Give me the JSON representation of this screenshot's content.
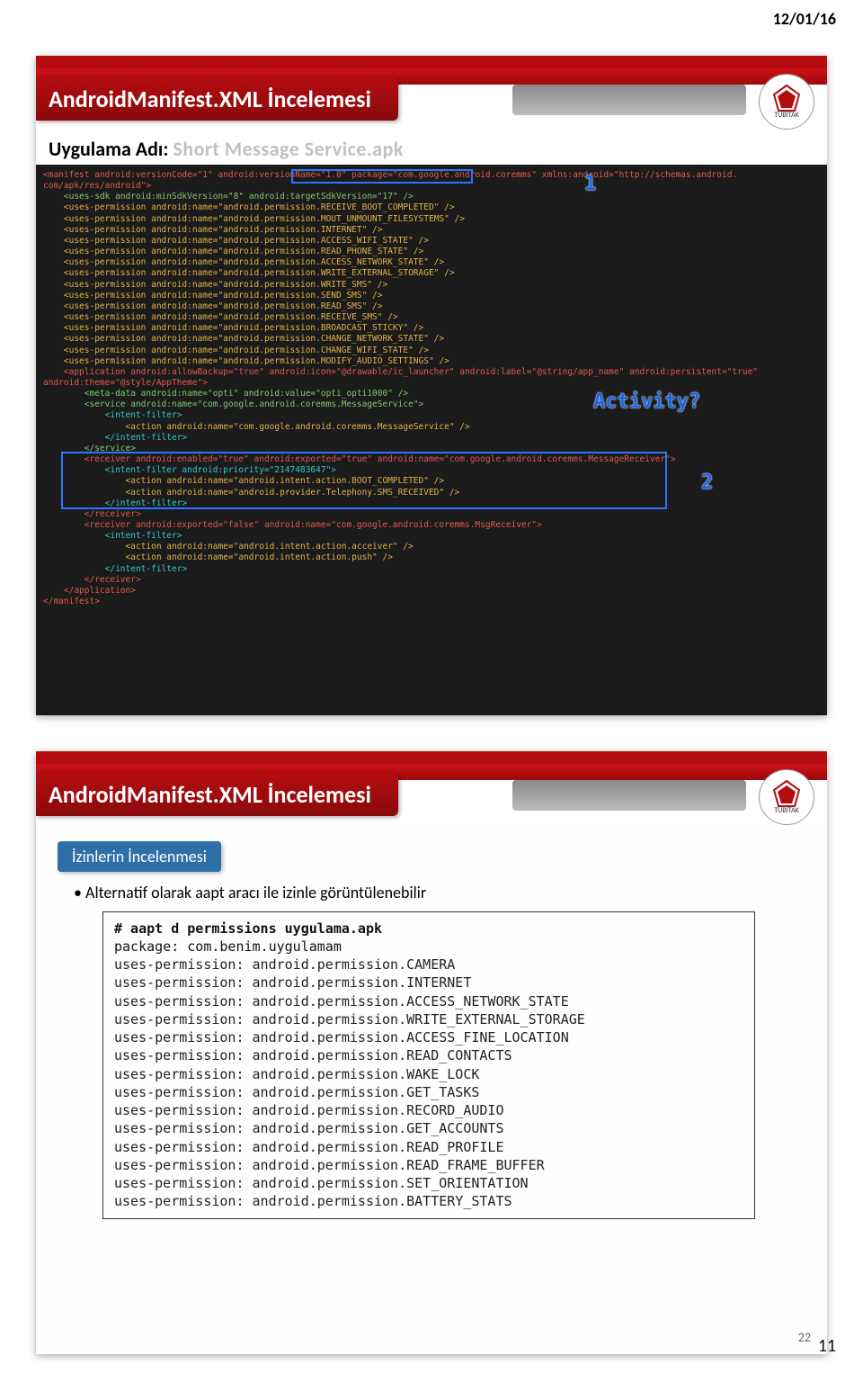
{
  "date": "12/01/16",
  "footer_page": "11",
  "slide1": {
    "title": "AndroidManifest.XML İncelemesi",
    "logo_caption": "TÜBİTAK",
    "app_label": "Uygulama Adı: ",
    "app_name": "Short Message Service.apk",
    "annot_1": "1",
    "annot_2": "2",
    "annot_activity": "Activity?",
    "manifest_lines": [
      {
        "cls": "c-red",
        "txt": "<manifest android:versionCode=\"1\" android:versionName=\"1.0\" package=\"com.google.android.coremms\" xmlns:android=\"http://schemas.android."
      },
      {
        "cls": "c-red",
        "txt": "com/apk/res/android\">"
      },
      {
        "cls": "c-green",
        "txt": "    <uses-sdk android:minSdkVersion=\"8\" android:targetSdkVersion=\"17\" />"
      },
      {
        "cls": "c-orange",
        "txt": "    <uses-permission android:name=\"android.permission.RECEIVE_BOOT_COMPLETED\" />"
      },
      {
        "cls": "c-orange",
        "txt": "    <uses-permission android:name=\"android.permission.MOUT_UNMOUNT_FILESYSTEMS\" />"
      },
      {
        "cls": "c-orange",
        "txt": "    <uses-permission android:name=\"android.permission.INTERNET\" />"
      },
      {
        "cls": "c-orange",
        "txt": "    <uses-permission android:name=\"android.permission.ACCESS_WIFI_STATE\" />"
      },
      {
        "cls": "c-orange",
        "txt": "    <uses-permission android:name=\"android.permission.READ_PHONE_STATE\" />"
      },
      {
        "cls": "c-orange",
        "txt": "    <uses-permission android:name=\"android.permission.ACCESS_NETWORK_STATE\" />"
      },
      {
        "cls": "c-orange",
        "txt": "    <uses-permission android:name=\"android.permission.WRITE_EXTERNAL_STORAGE\" />"
      },
      {
        "cls": "c-orange",
        "txt": "    <uses-permission android:name=\"android.permission.WRITE_SMS\" />"
      },
      {
        "cls": "c-orange",
        "txt": "    <uses-permission android:name=\"android.permission.SEND_SMS\" />"
      },
      {
        "cls": "c-orange",
        "txt": "    <uses-permission android:name=\"android.permission.READ_SMS\" />"
      },
      {
        "cls": "c-orange",
        "txt": "    <uses-permission android:name=\"android.permission.RECEIVE_SMS\" />"
      },
      {
        "cls": "c-orange",
        "txt": "    <uses-permission android:name=\"android.permission.BROADCAST_STICKY\" />"
      },
      {
        "cls": "c-orange",
        "txt": "    <uses-permission android:name=\"android.permission.CHANGE_NETWORK_STATE\" />"
      },
      {
        "cls": "c-orange",
        "txt": "    <uses-permission android:name=\"android.permission.CHANGE_WIFI_STATE\" />"
      },
      {
        "cls": "c-orange",
        "txt": "    <uses-permission android:name=\"android.permission.MODIFY_AUDIO_SETTINGS\" />"
      },
      {
        "cls": "c-red",
        "txt": "    <application android:allowBackup=\"true\" android:icon=\"@drawable/ic_launcher\" android:label=\"@string/app_name\" android:persistent=\"true\""
      },
      {
        "cls": "c-red",
        "txt": "android:theme=\"@style/AppTheme\">"
      },
      {
        "cls": "c-green",
        "txt": "        <meta-data android:name=\"opti\" android:value=\"opti_opti1000\" />"
      },
      {
        "cls": "c-green",
        "txt": "        <service android:name=\"com.google.android.coremms.MessageService\">"
      },
      {
        "cls": "c-cyan",
        "txt": "            <intent-filter>"
      },
      {
        "cls": "c-orange",
        "txt": "                <action android:name=\"com.google.android.coremms.MessageService\" />"
      },
      {
        "cls": "c-cyan",
        "txt": "            </intent-filter>"
      },
      {
        "cls": "c-green",
        "txt": "        </service>"
      },
      {
        "cls": "c-red",
        "txt": "        <receiver android:enabled=\"true\" android:exported=\"true\" android:name=\"com.google.android.coremms.MessageReceiver\">"
      },
      {
        "cls": "c-cyan",
        "txt": "            <intent-filter android:priority=\"2147483647\">"
      },
      {
        "cls": "c-orange",
        "txt": "                <action android:name=\"android.intent.action.BOOT_COMPLETED\" />"
      },
      {
        "cls": "c-orange",
        "txt": "                <action android:name=\"android.provider.Telephony.SMS_RECEIVED\" />"
      },
      {
        "cls": "c-cyan",
        "txt": "            </intent-filter>"
      },
      {
        "cls": "c-red",
        "txt": "        </receiver>"
      },
      {
        "cls": "c-red",
        "txt": "        <receiver android:exported=\"false\" android:name=\"com.google.android.coremms.MsgReceiver\">"
      },
      {
        "cls": "c-cyan",
        "txt": "            <intent-filter>"
      },
      {
        "cls": "c-orange",
        "txt": "                <action android:name=\"android.intent.action.acceiver\" />"
      },
      {
        "cls": "c-orange",
        "txt": "                <action android:name=\"android.intent.action.push\" />"
      },
      {
        "cls": "c-cyan",
        "txt": "            </intent-filter>"
      },
      {
        "cls": "c-red",
        "txt": "        </receiver>"
      },
      {
        "cls": "c-red",
        "txt": "    </application>"
      },
      {
        "cls": "c-red",
        "txt": "</manifest>"
      }
    ]
  },
  "slide2": {
    "title": "AndroidManifest.XML İncelemesi",
    "logo_caption": "TÜBİTAK",
    "section": "İzinlerin İncelenmesi",
    "bullet": "Alternatif olarak aapt aracı ile izinle görüntülenebilir",
    "page_number": "22",
    "perm": {
      "cmd": "# aapt d permissions uygulama.apk",
      "pkg": "package: com.benim.uygulamam",
      "lines": [
        "uses-permission: android.permission.CAMERA",
        "uses-permission: android.permission.INTERNET",
        "uses-permission: android.permission.ACCESS_NETWORK_STATE",
        "uses-permission: android.permission.WRITE_EXTERNAL_STORAGE",
        "uses-permission: android.permission.ACCESS_FINE_LOCATION",
        "uses-permission: android.permission.READ_CONTACTS",
        "uses-permission: android.permission.WAKE_LOCK",
        "uses-permission: android.permission.GET_TASKS",
        "uses-permission: android.permission.RECORD_AUDIO",
        "uses-permission: android.permission.GET_ACCOUNTS",
        "uses-permission: android.permission.READ_PROFILE",
        "uses-permission: android.permission.READ_FRAME_BUFFER",
        "uses-permission: android.permission.SET_ORIENTATION",
        "uses-permission: android.permission.BATTERY_STATS"
      ]
    }
  }
}
